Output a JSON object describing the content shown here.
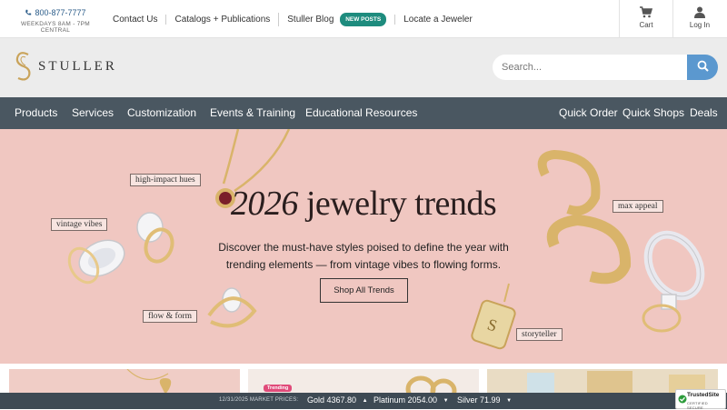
{
  "topbar": {
    "phone": "800-877-7777",
    "hours": "WEEKDAYS 8AM - 7PM CENTRAL",
    "links": [
      "Contact Us",
      "Catalogs + Publications",
      "Stuller Blog",
      "Locate a Jeweler"
    ],
    "blog_badge": "NEW POSTS",
    "cart_label": "Cart",
    "login_label": "Log In"
  },
  "header": {
    "logo_text": "STULLER",
    "search_placeholder": "Search..."
  },
  "nav": {
    "left": [
      "Products",
      "Services",
      "Customization",
      "Events & Training",
      "Educational Resources"
    ],
    "right": [
      "Quick Order",
      "Quick Shops",
      "Deals"
    ]
  },
  "hero": {
    "title_year": "2026",
    "title_rest": "jewelry trends",
    "subtitle": "Discover the must-have styles poised to define the year with trending elements — from vintage vibes to flowing forms.",
    "button": "Shop All Trends",
    "tags": [
      "high-impact hues",
      "vintage vibes",
      "flow & form",
      "max appeal",
      "storyteller"
    ]
  },
  "cards": {
    "trending_badge": "Trending"
  },
  "ticker": {
    "date_label": "12/31/2025 MARKET PRICES:",
    "items": [
      {
        "metal": "Gold",
        "price": "4367.80"
      },
      {
        "metal": "Platinum",
        "price": "2054.00"
      },
      {
        "metal": "Silver",
        "price": "71.99"
      }
    ]
  },
  "trusted": {
    "title": "TrustedSite",
    "subtitle": "CERTIFIED SECURE"
  },
  "colors": {
    "nav_bg": "#4a5761",
    "hero_bg": "#f0c7c1",
    "accent_blue": "#5b98cf",
    "badge_teal": "#1e8c7e",
    "gold": "#d9b46a"
  }
}
